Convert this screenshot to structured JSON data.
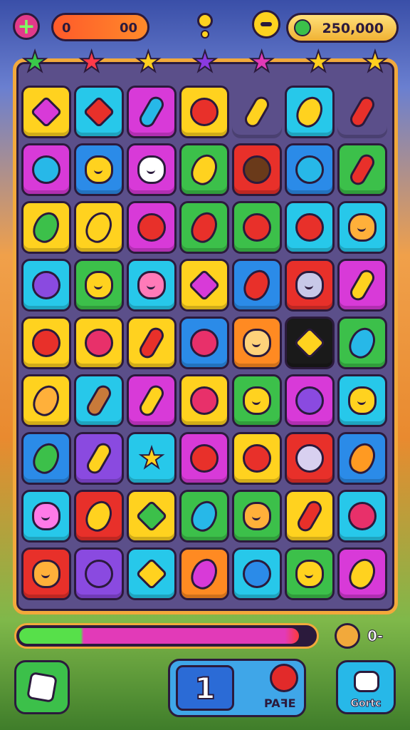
{
  "hud": {
    "left_counter_a": "0",
    "left_counter_b": "00",
    "coins": "250,000"
  },
  "stars": [
    "#3ac94a",
    "#ff3a4a",
    "#ffcf1f",
    "#8a3ae0",
    "#e23ab8",
    "#ffcf1f",
    "#ffcf1f"
  ],
  "colors": {
    "yellow": "#ffd21f",
    "cyan": "#27c8ea",
    "magenta": "#d83ad8",
    "green": "#3cc04a",
    "red": "#e8302a",
    "blue": "#2b8be8",
    "purple": "#8a4ae0",
    "orange": "#ff8a22",
    "black": "#1a1a1a"
  },
  "board": [
    [
      [
        "yellow",
        "diamond",
        "#d83ad8"
      ],
      [
        "cyan",
        "diamond",
        "#e8302a"
      ],
      [
        "magenta",
        "pill",
        "#27b8e8"
      ],
      [
        "yellow",
        "round",
        "#e8302a"
      ],
      [
        "none",
        "pill",
        "#ffd21f"
      ],
      [
        "cyan",
        "oval",
        "#ffd21f"
      ],
      [
        "none",
        "pill",
        "#e8302a"
      ]
    ],
    [
      [
        "magenta",
        "round",
        "#27b8e8"
      ],
      [
        "blue",
        "face",
        "#ffd21f"
      ],
      [
        "magenta",
        "face",
        "#ffffff"
      ],
      [
        "green",
        "oval",
        "#ffd21f"
      ],
      [
        "red",
        "round",
        "#6a3a1a"
      ],
      [
        "blue",
        "round",
        "#27b8e8"
      ],
      [
        "green",
        "pill",
        "#e8302a"
      ]
    ],
    [
      [
        "yellow",
        "oval",
        "#3cc04a"
      ],
      [
        "yellow",
        "oval",
        "#ffd21f"
      ],
      [
        "magenta",
        "round",
        "#e8302a"
      ],
      [
        "green",
        "oval",
        "#e8302a"
      ],
      [
        "green",
        "round",
        "#e8302a"
      ],
      [
        "cyan",
        "round",
        "#e8302a"
      ],
      [
        "cyan",
        "face",
        "#ffb03a"
      ]
    ],
    [
      [
        "cyan",
        "round",
        "#8a4ae0"
      ],
      [
        "green",
        "face",
        "#ffd21f"
      ],
      [
        "cyan",
        "face",
        "#ff7ab8"
      ],
      [
        "yellow",
        "diamond",
        "#d83ad8"
      ],
      [
        "blue",
        "oval",
        "#e8302a"
      ],
      [
        "red",
        "face",
        "#c8c8e8"
      ],
      [
        "magenta",
        "pill",
        "#ffd21f"
      ]
    ],
    [
      [
        "yellow",
        "round",
        "#e8302a"
      ],
      [
        "yellow",
        "round",
        "#e8306a"
      ],
      [
        "yellow",
        "pill",
        "#e8302a"
      ],
      [
        "blue",
        "round",
        "#e8306a"
      ],
      [
        "orange",
        "face",
        "#ffd27a"
      ],
      [
        "black",
        "diamond",
        "#ffd21f"
      ],
      [
        "green",
        "oval",
        "#27b8e8"
      ]
    ],
    [
      [
        "yellow",
        "oval",
        "#ffb03a"
      ],
      [
        "cyan",
        "pill",
        "#c87a3a"
      ],
      [
        "magenta",
        "pill",
        "#ffd21f"
      ],
      [
        "yellow",
        "round",
        "#e8306a"
      ],
      [
        "green",
        "face",
        "#ffd21f"
      ],
      [
        "magenta",
        "round",
        "#8a4ae0"
      ],
      [
        "cyan",
        "face",
        "#ffd21f"
      ]
    ],
    [
      [
        "blue",
        "oval",
        "#3cc04a"
      ],
      [
        "purple",
        "pill",
        "#ffd21f"
      ],
      [
        "cyan",
        "star5",
        "#ffd21f"
      ],
      [
        "magenta",
        "round",
        "#e8302a"
      ],
      [
        "yellow",
        "round",
        "#e8302a"
      ],
      [
        "red",
        "round",
        "#d8d0f0"
      ],
      [
        "blue",
        "oval",
        "#ff9a22"
      ]
    ],
    [
      [
        "cyan",
        "face",
        "#ff7ae8"
      ],
      [
        "red",
        "oval",
        "#ffd21f"
      ],
      [
        "yellow",
        "diamond",
        "#3cc04a"
      ],
      [
        "green",
        "oval",
        "#27b8e8"
      ],
      [
        "green",
        "face",
        "#ffb03a"
      ],
      [
        "yellow",
        "pill",
        "#e8302a"
      ],
      [
        "cyan",
        "round",
        "#e8306a"
      ]
    ],
    [
      [
        "red",
        "face",
        "#ffb03a"
      ],
      [
        "purple",
        "round",
        "#8a4ae0"
      ],
      [
        "cyan",
        "diamond",
        "#ffd21f"
      ],
      [
        "orange",
        "oval",
        "#d83ad8"
      ],
      [
        "cyan",
        "round",
        "#2b8be8"
      ],
      [
        "green",
        "face",
        "#ffd21f"
      ],
      [
        "magenta",
        "oval",
        "#ffd21f"
      ]
    ]
  ],
  "progress": {
    "fraction": 0.95
  },
  "timer_value": "0-",
  "bottom": {
    "level": "1",
    "panel_label": "PAꟻE",
    "right_label": "Gortc"
  }
}
